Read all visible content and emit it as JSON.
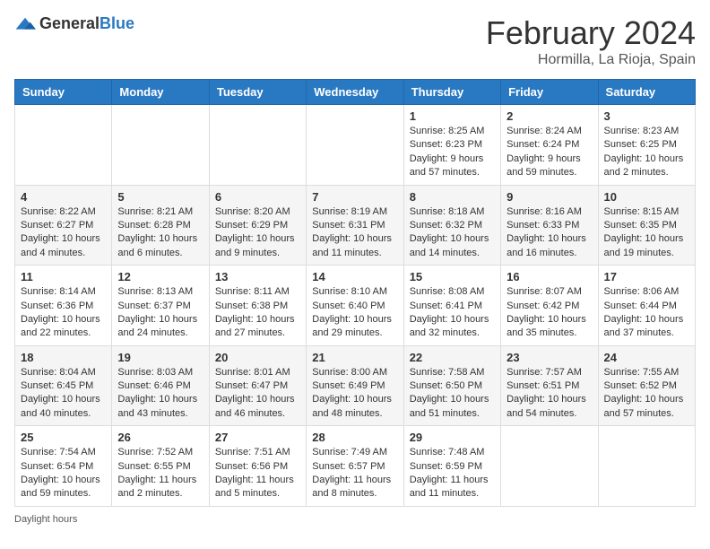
{
  "header": {
    "logo_general": "General",
    "logo_blue": "Blue",
    "title": "February 2024",
    "location": "Hormilla, La Rioja, Spain"
  },
  "days_of_week": [
    "Sunday",
    "Monday",
    "Tuesday",
    "Wednesday",
    "Thursday",
    "Friday",
    "Saturday"
  ],
  "weeks": [
    [
      {
        "day": "",
        "info": ""
      },
      {
        "day": "",
        "info": ""
      },
      {
        "day": "",
        "info": ""
      },
      {
        "day": "",
        "info": ""
      },
      {
        "day": "1",
        "info": "Sunrise: 8:25 AM\nSunset: 6:23 PM\nDaylight: 9 hours and 57 minutes."
      },
      {
        "day": "2",
        "info": "Sunrise: 8:24 AM\nSunset: 6:24 PM\nDaylight: 9 hours and 59 minutes."
      },
      {
        "day": "3",
        "info": "Sunrise: 8:23 AM\nSunset: 6:25 PM\nDaylight: 10 hours and 2 minutes."
      }
    ],
    [
      {
        "day": "4",
        "info": "Sunrise: 8:22 AM\nSunset: 6:27 PM\nDaylight: 10 hours and 4 minutes."
      },
      {
        "day": "5",
        "info": "Sunrise: 8:21 AM\nSunset: 6:28 PM\nDaylight: 10 hours and 6 minutes."
      },
      {
        "day": "6",
        "info": "Sunrise: 8:20 AM\nSunset: 6:29 PM\nDaylight: 10 hours and 9 minutes."
      },
      {
        "day": "7",
        "info": "Sunrise: 8:19 AM\nSunset: 6:31 PM\nDaylight: 10 hours and 11 minutes."
      },
      {
        "day": "8",
        "info": "Sunrise: 8:18 AM\nSunset: 6:32 PM\nDaylight: 10 hours and 14 minutes."
      },
      {
        "day": "9",
        "info": "Sunrise: 8:16 AM\nSunset: 6:33 PM\nDaylight: 10 hours and 16 minutes."
      },
      {
        "day": "10",
        "info": "Sunrise: 8:15 AM\nSunset: 6:35 PM\nDaylight: 10 hours and 19 minutes."
      }
    ],
    [
      {
        "day": "11",
        "info": "Sunrise: 8:14 AM\nSunset: 6:36 PM\nDaylight: 10 hours and 22 minutes."
      },
      {
        "day": "12",
        "info": "Sunrise: 8:13 AM\nSunset: 6:37 PM\nDaylight: 10 hours and 24 minutes."
      },
      {
        "day": "13",
        "info": "Sunrise: 8:11 AM\nSunset: 6:38 PM\nDaylight: 10 hours and 27 minutes."
      },
      {
        "day": "14",
        "info": "Sunrise: 8:10 AM\nSunset: 6:40 PM\nDaylight: 10 hours and 29 minutes."
      },
      {
        "day": "15",
        "info": "Sunrise: 8:08 AM\nSunset: 6:41 PM\nDaylight: 10 hours and 32 minutes."
      },
      {
        "day": "16",
        "info": "Sunrise: 8:07 AM\nSunset: 6:42 PM\nDaylight: 10 hours and 35 minutes."
      },
      {
        "day": "17",
        "info": "Sunrise: 8:06 AM\nSunset: 6:44 PM\nDaylight: 10 hours and 37 minutes."
      }
    ],
    [
      {
        "day": "18",
        "info": "Sunrise: 8:04 AM\nSunset: 6:45 PM\nDaylight: 10 hours and 40 minutes."
      },
      {
        "day": "19",
        "info": "Sunrise: 8:03 AM\nSunset: 6:46 PM\nDaylight: 10 hours and 43 minutes."
      },
      {
        "day": "20",
        "info": "Sunrise: 8:01 AM\nSunset: 6:47 PM\nDaylight: 10 hours and 46 minutes."
      },
      {
        "day": "21",
        "info": "Sunrise: 8:00 AM\nSunset: 6:49 PM\nDaylight: 10 hours and 48 minutes."
      },
      {
        "day": "22",
        "info": "Sunrise: 7:58 AM\nSunset: 6:50 PM\nDaylight: 10 hours and 51 minutes."
      },
      {
        "day": "23",
        "info": "Sunrise: 7:57 AM\nSunset: 6:51 PM\nDaylight: 10 hours and 54 minutes."
      },
      {
        "day": "24",
        "info": "Sunrise: 7:55 AM\nSunset: 6:52 PM\nDaylight: 10 hours and 57 minutes."
      }
    ],
    [
      {
        "day": "25",
        "info": "Sunrise: 7:54 AM\nSunset: 6:54 PM\nDaylight: 10 hours and 59 minutes."
      },
      {
        "day": "26",
        "info": "Sunrise: 7:52 AM\nSunset: 6:55 PM\nDaylight: 11 hours and 2 minutes."
      },
      {
        "day": "27",
        "info": "Sunrise: 7:51 AM\nSunset: 6:56 PM\nDaylight: 11 hours and 5 minutes."
      },
      {
        "day": "28",
        "info": "Sunrise: 7:49 AM\nSunset: 6:57 PM\nDaylight: 11 hours and 8 minutes."
      },
      {
        "day": "29",
        "info": "Sunrise: 7:48 AM\nSunset: 6:59 PM\nDaylight: 11 hours and 11 minutes."
      },
      {
        "day": "",
        "info": ""
      },
      {
        "day": "",
        "info": ""
      }
    ]
  ],
  "footer": {
    "daylight_label": "Daylight hours"
  }
}
